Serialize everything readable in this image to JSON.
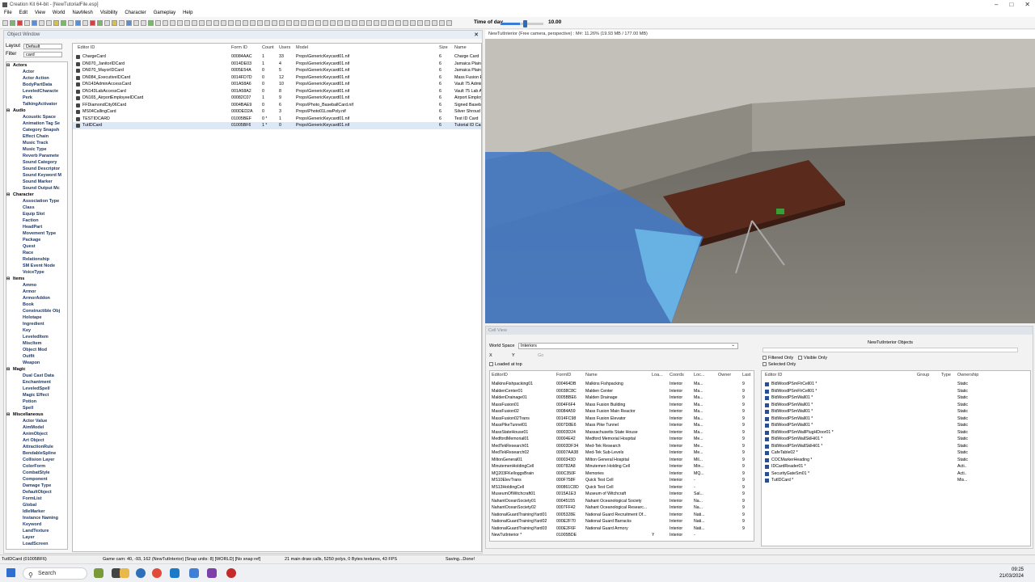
{
  "app": {
    "title": "Creation Kit 64-bit - [NewTutorialFile.esp]"
  },
  "menu": [
    "File",
    "Edit",
    "View",
    "World",
    "NavMesh",
    "Visibility",
    "Character",
    "Gameplay",
    "Help"
  ],
  "time_of_day": {
    "label": "Time of day",
    "value": "10.00",
    "progress": 0.45
  },
  "object_window": {
    "title": "Object Window",
    "layout_label": "Layout",
    "layout_value": "Default",
    "filter_label": "Filter",
    "filter_value": "card",
    "tree": [
      {
        "t": "cat",
        "l": "Actors"
      },
      {
        "t": "sub",
        "l": "Actor"
      },
      {
        "t": "sub",
        "l": "Actor Action"
      },
      {
        "t": "sub",
        "l": "BodyPartData"
      },
      {
        "t": "sub",
        "l": "LeveledCharacte"
      },
      {
        "t": "sub",
        "l": "Perk"
      },
      {
        "t": "sub",
        "l": "TalkingActivator"
      },
      {
        "t": "cat",
        "l": "Audio"
      },
      {
        "t": "sub",
        "l": "Acoustic Space"
      },
      {
        "t": "sub",
        "l": "Animation Tag Se"
      },
      {
        "t": "sub",
        "l": "Category Snapsh"
      },
      {
        "t": "sub",
        "l": "Effect Chain"
      },
      {
        "t": "sub",
        "l": "Music Track"
      },
      {
        "t": "sub",
        "l": "Music Type"
      },
      {
        "t": "sub",
        "l": "Reverb Paramete"
      },
      {
        "t": "sub",
        "l": "Sound Category"
      },
      {
        "t": "sub",
        "l": "Sound Descriptor"
      },
      {
        "t": "sub",
        "l": "Sound Keyword M"
      },
      {
        "t": "sub",
        "l": "Sound Marker"
      },
      {
        "t": "sub",
        "l": "Sound Output Mc"
      },
      {
        "t": "cat",
        "l": "Character"
      },
      {
        "t": "sub",
        "l": "Association Type"
      },
      {
        "t": "sub",
        "l": "Class"
      },
      {
        "t": "sub",
        "l": "Equip Slot"
      },
      {
        "t": "sub",
        "l": "Faction"
      },
      {
        "t": "sub",
        "l": "HeadPart"
      },
      {
        "t": "sub",
        "l": "Movement Type"
      },
      {
        "t": "sub",
        "l": "Package"
      },
      {
        "t": "sub",
        "l": "Quest"
      },
      {
        "t": "sub",
        "l": "Race"
      },
      {
        "t": "sub",
        "l": "Relationship"
      },
      {
        "t": "sub",
        "l": "SM Event Node"
      },
      {
        "t": "sub",
        "l": "VoiceType"
      },
      {
        "t": "cat",
        "l": "Items"
      },
      {
        "t": "sub",
        "l": "Ammo"
      },
      {
        "t": "sub",
        "l": "Armor"
      },
      {
        "t": "sub",
        "l": "ArmorAddon"
      },
      {
        "t": "sub",
        "l": "Book"
      },
      {
        "t": "sub",
        "l": "Constructible Obj"
      },
      {
        "t": "sub",
        "l": "Holotape"
      },
      {
        "t": "sub",
        "l": "Ingredient"
      },
      {
        "t": "sub",
        "l": "Key"
      },
      {
        "t": "sub",
        "l": "LeveledItem"
      },
      {
        "t": "sub",
        "l": "MiscItem"
      },
      {
        "t": "sub",
        "l": "Object Mod"
      },
      {
        "t": "sub",
        "l": "Outfit"
      },
      {
        "t": "sub",
        "l": "Weapon"
      },
      {
        "t": "cat",
        "l": "Magic"
      },
      {
        "t": "sub",
        "l": "Dual Cast Data"
      },
      {
        "t": "sub",
        "l": "Enchantment"
      },
      {
        "t": "sub",
        "l": "LeveledSpell"
      },
      {
        "t": "sub",
        "l": "Magic Effect"
      },
      {
        "t": "sub",
        "l": "Potion"
      },
      {
        "t": "sub",
        "l": "Spell"
      },
      {
        "t": "cat",
        "l": "Miscellaneous"
      },
      {
        "t": "sub",
        "l": "Actor Value"
      },
      {
        "t": "sub",
        "l": "AimModel"
      },
      {
        "t": "sub",
        "l": "AnimObject"
      },
      {
        "t": "sub",
        "l": "Art Object"
      },
      {
        "t": "sub",
        "l": "AttractionRule"
      },
      {
        "t": "sub",
        "l": "BendableSpline"
      },
      {
        "t": "sub",
        "l": "Collision Layer"
      },
      {
        "t": "sub",
        "l": "ColorForm"
      },
      {
        "t": "sub",
        "l": "CombatStyle"
      },
      {
        "t": "sub",
        "l": "Component"
      },
      {
        "t": "sub",
        "l": "Damage Type"
      },
      {
        "t": "sub",
        "l": "DefaultObject"
      },
      {
        "t": "sub",
        "l": "FormList"
      },
      {
        "t": "sub",
        "l": "Global"
      },
      {
        "t": "sub",
        "l": "IdleMarker"
      },
      {
        "t": "sub",
        "l": "Instance Naming"
      },
      {
        "t": "sub",
        "l": "Keyword"
      },
      {
        "t": "sub",
        "l": "LandTexture"
      },
      {
        "t": "sub",
        "l": "Layer"
      },
      {
        "t": "sub",
        "l": "LoadScreen"
      }
    ],
    "columns": [
      "Editor ID",
      "Form ID",
      "Count",
      "Users",
      "Model",
      "Size",
      "Name"
    ],
    "rows": [
      [
        "ChargeCard",
        "00084AAC",
        "1",
        "33",
        "Props\\GenericKeycard01.nif",
        "6",
        "Charge Card"
      ],
      [
        "DN070_JanitorIDCard",
        "0014DE03",
        "1",
        "4",
        "Props\\GenericKeycard01.nif",
        "6",
        "Jamaica Plain Ja"
      ],
      [
        "DN070_MayorIDCard",
        "0005E54A",
        "0",
        "5",
        "Props\\GenericKeycard01.nif",
        "6",
        "Jamaica Plain M"
      ],
      [
        "DN084_ExecutiveIDCard",
        "0014FD7D",
        "0",
        "12",
        "Props\\GenericKeycard01.nif",
        "6",
        "Mass Fusion Exe"
      ],
      [
        "DN143AdminAccessCard",
        "001A58A6",
        "0",
        "10",
        "Props\\GenericKeycard01.nif",
        "6",
        "Vault 75 Admin A"
      ],
      [
        "DN143LabAccessCard",
        "001A58A2",
        "0",
        "8",
        "Props\\GenericKeycard01.nif",
        "6",
        "Vault 75 Lab Acc"
      ],
      [
        "DN165_AirportEmployeeIDCard",
        "00082C07",
        "1",
        "9",
        "Props\\GenericKeycard01.nif",
        "6",
        "Airport Employee"
      ],
      [
        "FFDiamondCity06Card",
        "0004BAE9",
        "0",
        "6",
        "Props\\Photo_BaseballCard.nif",
        "6",
        "Signed Baseball"
      ],
      [
        "MS04CallingCard",
        "000DED2A",
        "0",
        "3",
        "Props\\Photo01LowPoly.nif",
        "6",
        "Silver Shroud Ca"
      ],
      [
        "TESTIDCARD",
        "01005BEF",
        "0 *",
        "1",
        "Props\\GenericKeycard01.nif",
        "6",
        "Test ID Card"
      ],
      [
        "TutIDCard",
        "01005BF6",
        "1 *",
        "0",
        "Props\\GenericKeycard01.nif",
        "6",
        "Tutorial ID Card"
      ]
    ]
  },
  "render": {
    "title": "NewTutInterior (Free camera, perspective) : M#: 11.26% (19.93 MB / 177.00 MB)"
  },
  "cell_view": {
    "title": "Cell View",
    "worldspace_label": "World Space",
    "worldspace_value": "Interiors",
    "x_label": "X",
    "y_label": "Y",
    "go_label": "Go",
    "loaded_at_top": "Loaded at top",
    "objects_title": "NewTutInterior Objects",
    "filtered_only": "Filtered Only",
    "visible_only": "Visible Only",
    "selected_only": "Selected Only",
    "cell_columns": [
      "EditorID",
      "FormID",
      "Name",
      "Loa...",
      "Coords",
      "Loc...",
      "Owner",
      "Last"
    ],
    "cells": [
      [
        "MalkinsFishpacking01",
        "000464DB",
        "Malkins Fishpacking",
        "",
        "Interior",
        "Ma...",
        "",
        "9"
      ],
      [
        "MaldenCenter01",
        "00038C8C",
        "Malden Center",
        "",
        "Interior",
        "Ma...",
        "",
        "9"
      ],
      [
        "MaldenDrainage01",
        "0005BBE6",
        "Malden Drainage",
        "",
        "Interior",
        "Ma...",
        "",
        "9"
      ],
      [
        "MassFusion01",
        "0004F6F4",
        "Mass Fusion Building",
        "",
        "Interior",
        "Ma...",
        "",
        "9"
      ],
      [
        "MassFusion02",
        "00084A59",
        "Mass Fusion Main Reactor",
        "",
        "Interior",
        "Ma...",
        "",
        "9"
      ],
      [
        "MassFusion02Trans",
        "0014FC98",
        "Mass Fusion Elevator",
        "",
        "Interior",
        "Ma...",
        "",
        "9"
      ],
      [
        "MassPikeTunnel01",
        "0007D8E6",
        "Mass Pike Tunnel",
        "",
        "Interior",
        "Ma...",
        "",
        "9"
      ],
      [
        "MassStateHouse01",
        "00003D24",
        "Massachusetts State House",
        "",
        "Interior",
        "Ma...",
        "",
        "9"
      ],
      [
        "MedfordMemorial01",
        "00004E42",
        "Medford Memorial Hospital",
        "",
        "Interior",
        "Me...",
        "",
        "9"
      ],
      [
        "MedTekResearch01",
        "00003DF34",
        "Med-Tek Research",
        "",
        "Interior",
        "Me...",
        "",
        "9"
      ],
      [
        "MedTekResearch02",
        "00007AA38",
        "Med-Tek Sub-Levels",
        "",
        "Interior",
        "Me...",
        "",
        "9"
      ],
      [
        "MiltonGeneral01",
        "0000343D",
        "Milton General Hospital",
        "",
        "Interior",
        "Mil...",
        "",
        "9"
      ],
      [
        "MinutemenHoldingCell",
        "000782A8",
        "Minutemen Holding Cell",
        "",
        "Interior",
        "Min...",
        "",
        "9"
      ],
      [
        "MQ203FKelloggsBrain",
        "000C350F",
        "Memories",
        "",
        "Interior",
        "MQ...",
        "",
        "9"
      ],
      [
        "MS10ElevTrans",
        "000F758F",
        "Quick Test Cell",
        "",
        "Interior",
        "-",
        "",
        "9"
      ],
      [
        "MS13HoldingCell",
        "000861C8D",
        "Quick Test Cell",
        "",
        "Interior",
        "-",
        "",
        "9"
      ],
      [
        "MuseumOfWitchcraft01",
        "0015A1E3",
        "Museum of Witchcraft",
        "",
        "Interior",
        "Sal...",
        "",
        "9"
      ],
      [
        "NahantOceanSociety01",
        "00045155",
        "Nahant Oceanological Society",
        "",
        "Interior",
        "Na...",
        "",
        "9"
      ],
      [
        "NahantOceanSociety02",
        "0007FF42",
        "Nahant Oceanological Researc...",
        "",
        "Interior",
        "Na...",
        "",
        "9"
      ],
      [
        "NationalGuardTrainingYard01",
        "0005328E",
        "National Guard Recruitment Of...",
        "",
        "Interior",
        "Nati...",
        "",
        "9"
      ],
      [
        "NationalGuardTrainingYard02",
        "000E2F70",
        "National Guard Barracks",
        "",
        "Interior",
        "Nati...",
        "",
        "9"
      ],
      [
        "NationalGuardTrainingYard03",
        "000E2F6F",
        "National Guard Armory",
        "",
        "Interior",
        "Nati...",
        "",
        "9"
      ],
      [
        "NewTutInterior *",
        "01005BDE",
        "",
        "Y",
        "Interior",
        "-",
        "",
        ""
      ]
    ],
    "obj_columns": [
      "Editor ID",
      "Group",
      "Type",
      "Ownership"
    ],
    "objects": [
      [
        "BldWoodPSmFlrCell01 *",
        "",
        "Static"
      ],
      [
        "BldWoodPSmFlrCell01 *",
        "",
        "Static"
      ],
      [
        "BldWoodPSmWall01 *",
        "",
        "Static"
      ],
      [
        "BldWoodPSmWall01 *",
        "",
        "Static"
      ],
      [
        "BldWoodPSmWall01 *",
        "",
        "Static"
      ],
      [
        "BldWoodPSmWall01 *",
        "",
        "Static"
      ],
      [
        "BldWoodPSmWall01 *",
        "",
        "Static"
      ],
      [
        "BldWoodPSmWallPlugHDoor01 *",
        "",
        "Static"
      ],
      [
        "BldWoodPSmWallSklHi01 *",
        "",
        "Static"
      ],
      [
        "BldWoodPSmWallSklHi01 *",
        "",
        "Static"
      ],
      [
        "CafeTable02 *",
        "",
        "Static"
      ],
      [
        "COCMarkerHeading *",
        "",
        "Static"
      ],
      [
        "IDCardReader01 *",
        "",
        "Acti.."
      ],
      [
        "SecurityGateSm01 *",
        "",
        "Acti.."
      ],
      [
        "TutIDCard *",
        "",
        "Mis..."
      ]
    ]
  },
  "status": {
    "left": "TutIDCard (01005BF6)",
    "cam": "Game cam: 40, -93, 162 (NewTutInterior) [Snap units: 8] [WORLD] [No snap ref]",
    "draw": "21 main draw calls, 5250 polys, 0 Bytes textures, 43 FPS",
    "saving": "Saving...Done!"
  },
  "taskbar": {
    "search": "Search",
    "time": "09:25",
    "date": "21/03/2024"
  }
}
